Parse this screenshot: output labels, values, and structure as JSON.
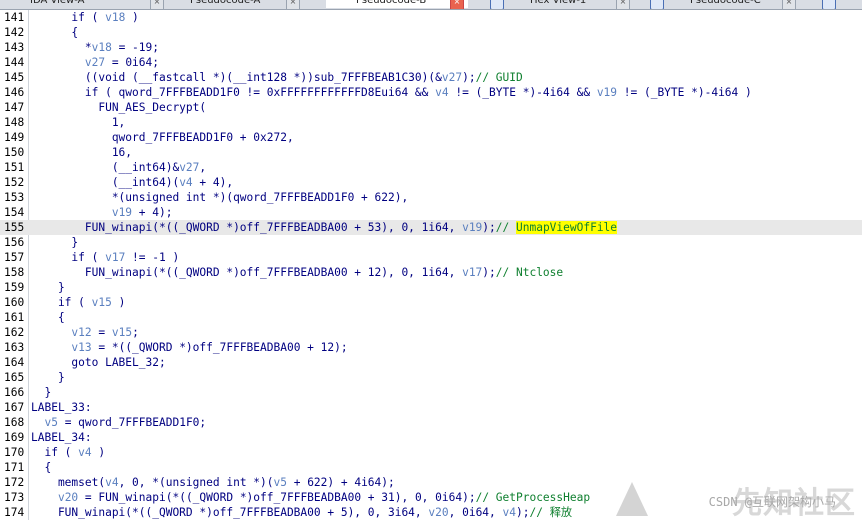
{
  "tabs": [
    {
      "label": "IDA View-A"
    },
    {
      "label": "Pseudocode-A"
    },
    {
      "label": "Pseudocode-B"
    },
    {
      "label": "Hex View-1"
    },
    {
      "label": "Pseudocode-C"
    }
  ],
  "lines": [
    {
      "n": "141",
      "t": [
        [
          "      if ( ",
          "p"
        ],
        [
          "v18",
          "v"
        ],
        [
          " )",
          "p"
        ]
      ]
    },
    {
      "n": "142",
      "t": [
        [
          "      {",
          "p"
        ]
      ]
    },
    {
      "n": "143",
      "t": [
        [
          "        *",
          "p"
        ],
        [
          "v18",
          "v"
        ],
        [
          " = -19;",
          "p"
        ]
      ]
    },
    {
      "n": "144",
      "t": [
        [
          "        ",
          "p"
        ],
        [
          "v27",
          "v"
        ],
        [
          " = 0i64;",
          "p"
        ]
      ]
    },
    {
      "n": "145",
      "t": [
        [
          "        ((void (__fastcall *)(__int128 *))sub_7FFFBEAB1C30)(&",
          "p"
        ],
        [
          "v27",
          "v"
        ],
        [
          ");",
          "p"
        ],
        [
          "// GUID",
          "c"
        ]
      ]
    },
    {
      "n": "146",
      "t": [
        [
          "        if ( qword_7FFFBEADD1F0 != 0xFFFFFFFFFFFFD8Eui64 && ",
          "p"
        ],
        [
          "v4",
          "v"
        ],
        [
          " != (_BYTE *)-4i64 && ",
          "p"
        ],
        [
          "v19",
          "v"
        ],
        [
          " != (_BYTE *)-4i64 )",
          "p"
        ]
      ]
    },
    {
      "n": "147",
      "t": [
        [
          "          FUN_AES_Decrypt(",
          "p"
        ]
      ]
    },
    {
      "n": "148",
      "t": [
        [
          "            1,",
          "p"
        ]
      ]
    },
    {
      "n": "149",
      "t": [
        [
          "            qword_7FFFBEADD1F0 + 0x272,",
          "p"
        ]
      ]
    },
    {
      "n": "150",
      "t": [
        [
          "            16,",
          "p"
        ]
      ]
    },
    {
      "n": "151",
      "t": [
        [
          "            (__int64)&",
          "p"
        ],
        [
          "v27",
          "v"
        ],
        [
          ",",
          "p"
        ]
      ]
    },
    {
      "n": "152",
      "t": [
        [
          "            (__int64)(",
          "p"
        ],
        [
          "v4",
          "v"
        ],
        [
          " + 4),",
          "p"
        ]
      ]
    },
    {
      "n": "153",
      "t": [
        [
          "            *(unsigned int *)(qword_7FFFBEADD1F0 + 622),",
          "p"
        ]
      ]
    },
    {
      "n": "154",
      "t": [
        [
          "            ",
          "p"
        ],
        [
          "v19",
          "v"
        ],
        [
          " + 4);",
          "p"
        ]
      ]
    },
    {
      "n": "155",
      "hl": true,
      "t": [
        [
          "        FUN_winapi(*((_QWORD *)off_7FFFBEADBA00 + 53), 0, 1i64, ",
          "p"
        ],
        [
          "v19",
          "v"
        ],
        [
          ");",
          "p"
        ],
        [
          "// ",
          "c"
        ],
        [
          "UnmapViewOfFile",
          "h"
        ]
      ]
    },
    {
      "n": "156",
      "t": [
        [
          "      }",
          "p"
        ]
      ]
    },
    {
      "n": "157",
      "t": [
        [
          "      if ( ",
          "p"
        ],
        [
          "v17",
          "v"
        ],
        [
          " != -1 )",
          "p"
        ]
      ]
    },
    {
      "n": "158",
      "t": [
        [
          "        FUN_winapi(*((_QWORD *)off_7FFFBEADBA00 + 12), 0, 1i64, ",
          "p"
        ],
        [
          "v17",
          "v"
        ],
        [
          ");",
          "p"
        ],
        [
          "// Ntclose",
          "c"
        ]
      ]
    },
    {
      "n": "159",
      "t": [
        [
          "    }",
          "p"
        ]
      ]
    },
    {
      "n": "160",
      "t": [
        [
          "    if ( ",
          "p"
        ],
        [
          "v15",
          "v"
        ],
        [
          " )",
          "p"
        ]
      ]
    },
    {
      "n": "161",
      "t": [
        [
          "    {",
          "p"
        ]
      ]
    },
    {
      "n": "162",
      "t": [
        [
          "      ",
          "p"
        ],
        [
          "v12",
          "v"
        ],
        [
          " = ",
          "p"
        ],
        [
          "v15",
          "v"
        ],
        [
          ";",
          "p"
        ]
      ]
    },
    {
      "n": "163",
      "t": [
        [
          "      ",
          "p"
        ],
        [
          "v13",
          "v"
        ],
        [
          " = *((_QWORD *)off_7FFFBEADBA00 + 12);",
          "p"
        ]
      ]
    },
    {
      "n": "164",
      "t": [
        [
          "      goto LABEL_32;",
          "p"
        ]
      ]
    },
    {
      "n": "165",
      "t": [
        [
          "    }",
          "p"
        ]
      ]
    },
    {
      "n": "166",
      "t": [
        [
          "  }",
          "p"
        ]
      ]
    },
    {
      "n": "167",
      "t": [
        [
          "LABEL_33:",
          "p"
        ]
      ]
    },
    {
      "n": "168",
      "t": [
        [
          "  ",
          "p"
        ],
        [
          "v5",
          "v"
        ],
        [
          " = qword_7FFFBEADD1F0;",
          "p"
        ]
      ]
    },
    {
      "n": "169",
      "t": [
        [
          "LABEL_34:",
          "p"
        ]
      ]
    },
    {
      "n": "170",
      "t": [
        [
          "  if ( ",
          "p"
        ],
        [
          "v4",
          "v"
        ],
        [
          " )",
          "p"
        ]
      ]
    },
    {
      "n": "171",
      "t": [
        [
          "  {",
          "p"
        ]
      ]
    },
    {
      "n": "172",
      "t": [
        [
          "    memset(",
          "p"
        ],
        [
          "v4",
          "v"
        ],
        [
          ", 0, *(unsigned int *)(",
          "p"
        ],
        [
          "v5",
          "v"
        ],
        [
          " + 622) + 4i64);",
          "p"
        ]
      ]
    },
    {
      "n": "173",
      "t": [
        [
          "    ",
          "p"
        ],
        [
          "v20",
          "v"
        ],
        [
          " = FUN_winapi(*((_QWORD *)off_7FFFBEADBA00 + 31), 0, 0i64);",
          "p"
        ],
        [
          "// GetProcessHeap",
          "c"
        ]
      ]
    },
    {
      "n": "174",
      "t": [
        [
          "    FUN_winapi(*((_QWORD *)off_7FFFBEADBA00 + 5), 0, 3i64, ",
          "p"
        ],
        [
          "v20",
          "v"
        ],
        [
          ", 0i64, ",
          "p"
        ],
        [
          "v4",
          "v"
        ],
        [
          ");",
          "p"
        ],
        [
          "// 释放",
          "c"
        ]
      ]
    }
  ],
  "watermark": {
    "big": "先知社区",
    "small": "CSDN @互联网架构小马"
  },
  "colors": {
    "code": "#000080",
    "variable": "#5a7fbf",
    "comment": "#108030",
    "highlight": "#ffff00",
    "current_line": "#e8e8e8"
  }
}
